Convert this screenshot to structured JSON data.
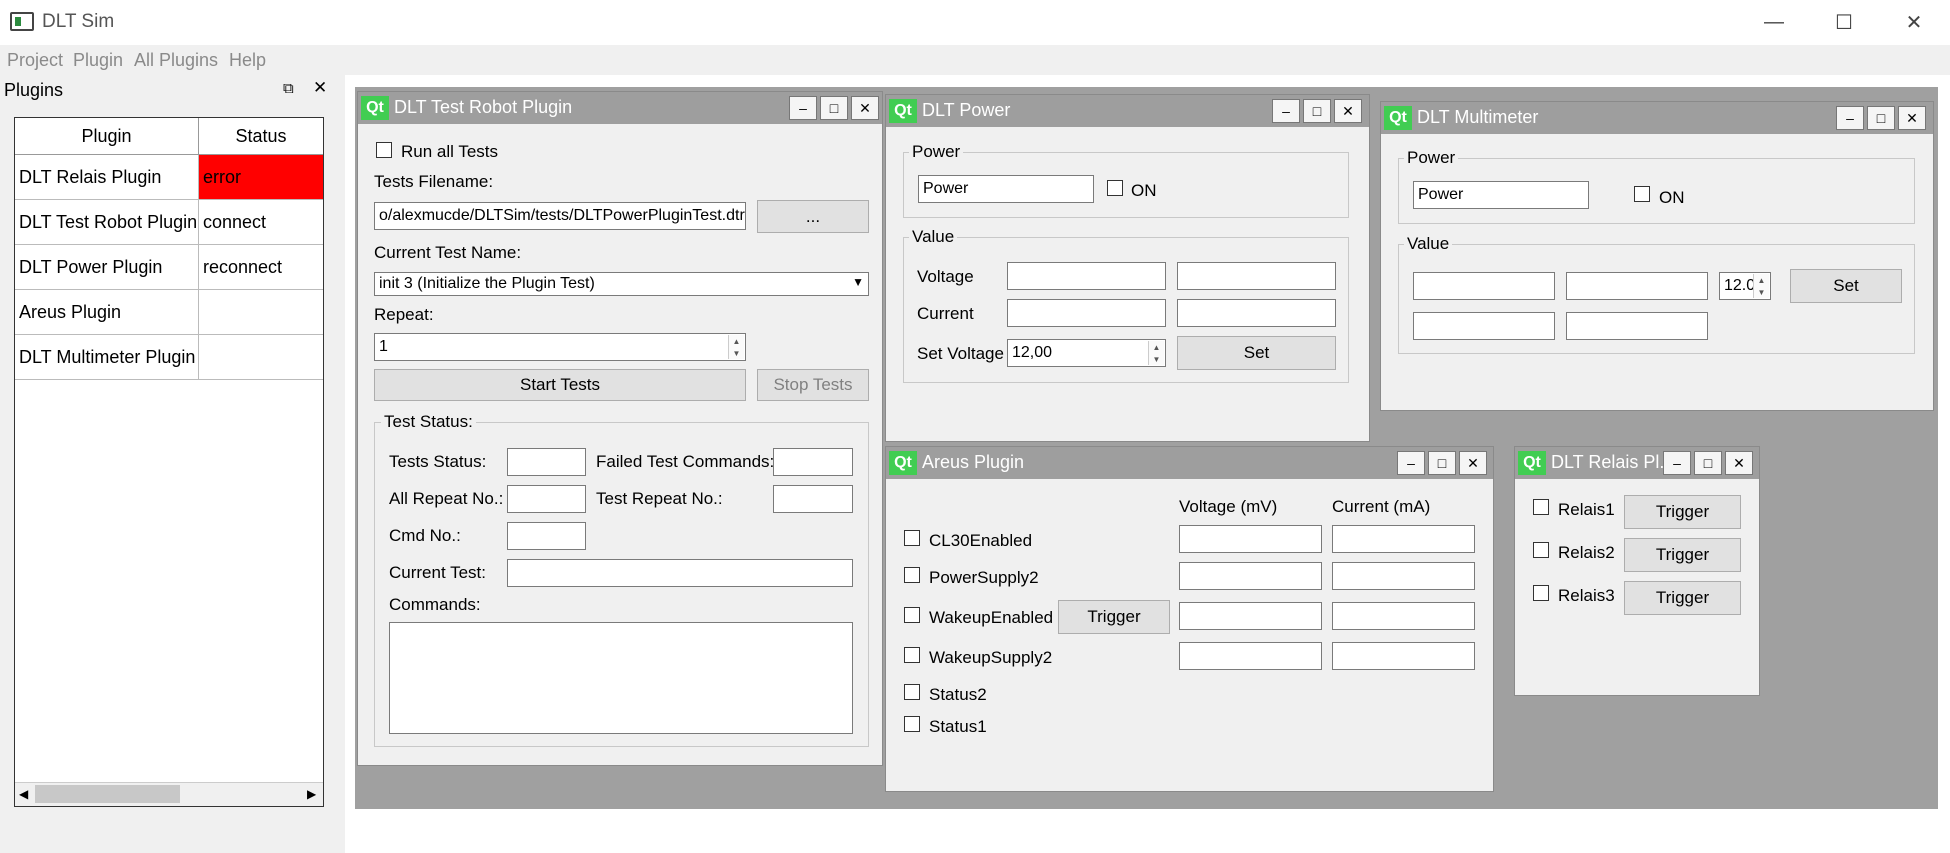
{
  "app": {
    "title": "DLT Sim"
  },
  "menubar": [
    "Project",
    "Plugin",
    "All Plugins",
    "Help"
  ],
  "dock": {
    "title": "Plugins",
    "columns": [
      "Plugin",
      "Status"
    ],
    "rows": [
      {
        "plugin": "DLT Relais Plugin",
        "status": "error"
      },
      {
        "plugin": "DLT Test Robot Plugin",
        "status": "connect"
      },
      {
        "plugin": "DLT Power Plugin",
        "status": "reconnect"
      },
      {
        "plugin": "Areus Plugin",
        "status": ""
      },
      {
        "plugin": "DLT Multimeter Plugin",
        "status": ""
      }
    ],
    "error_color": "#ff0000"
  },
  "robot": {
    "title": "DLT Test Robot Plugin",
    "run_all": "Run all Tests",
    "filename_label": "Tests Filename:",
    "filename_value": "o/alexmucde/DLTSim/tests/DLTPowerPluginTest.dtr",
    "browse": "...",
    "current_label": "Current Test Name:",
    "current_value": "init 3 (Initialize the Plugin Test)",
    "repeat_label": "Repeat:",
    "repeat_value": "1",
    "start": "Start Tests",
    "stop": "Stop Tests",
    "status_group": "Test Status:",
    "tests_status": "Tests Status:",
    "failed": "Failed Test Commands:",
    "all_repeat": "All Repeat No.:",
    "test_repeat": "Test Repeat No.:",
    "cmd_no": "Cmd No.:",
    "current_test": "Current Test:",
    "commands": "Commands:"
  },
  "power": {
    "title": "DLT Power",
    "group_power": "Power",
    "power_field": "Power",
    "on": "ON",
    "group_value": "Value",
    "voltage": "Voltage",
    "current": "Current",
    "set_voltage": "Set Voltage",
    "set_voltage_value": "12,00",
    "set": "Set"
  },
  "multimeter": {
    "title": "DLT Multimeter",
    "group_power": "Power",
    "power_field": "Power",
    "on": "ON",
    "group_value": "Value",
    "spin_value": "12.0",
    "set": "Set"
  },
  "areus": {
    "title": "Areus Plugin",
    "voltage_header": "Voltage (mV)",
    "current_header": "Current (mA)",
    "checks": [
      "CL30Enabled",
      "PowerSupply2",
      "WakeupEnabled",
      "WakeupSupply2",
      "Status2",
      "Status1"
    ],
    "trigger": "Trigger"
  },
  "relais": {
    "title": "DLT Relais Pl...",
    "items": [
      "Relais1",
      "Relais2",
      "Relais3"
    ],
    "trigger": "Trigger"
  },
  "icons": [
    "app-icon",
    "minimize-icon",
    "maximize-icon",
    "close-icon",
    "float-icon",
    "qt-logo-icon"
  ]
}
